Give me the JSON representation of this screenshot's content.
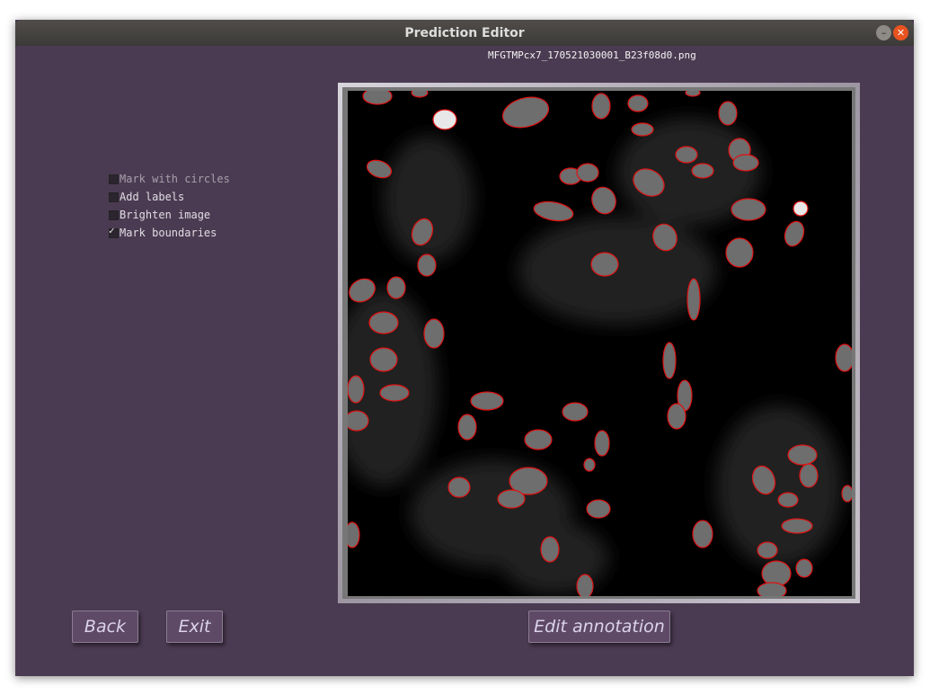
{
  "window": {
    "title": "Prediction Editor"
  },
  "filename": "MFGTMPcx7_170521030001_B23f08d0.png",
  "options": [
    {
      "label": "Mark with circles",
      "checked": false,
      "enabled": false
    },
    {
      "label": "Add labels",
      "checked": false,
      "enabled": true
    },
    {
      "label": "Brighten image",
      "checked": false,
      "enabled": true
    },
    {
      "label": "Mark boundaries",
      "checked": true,
      "enabled": true
    }
  ],
  "buttons": {
    "back": "Back",
    "exit": "Exit",
    "edit": "Edit annotation"
  },
  "colors": {
    "background": "#4b3b52",
    "boundary": "#e01010",
    "button": "#5e4a66",
    "button_text": "#dcd3ef"
  },
  "icons": {
    "minimize": "minimize-icon",
    "close": "close-icon"
  }
}
